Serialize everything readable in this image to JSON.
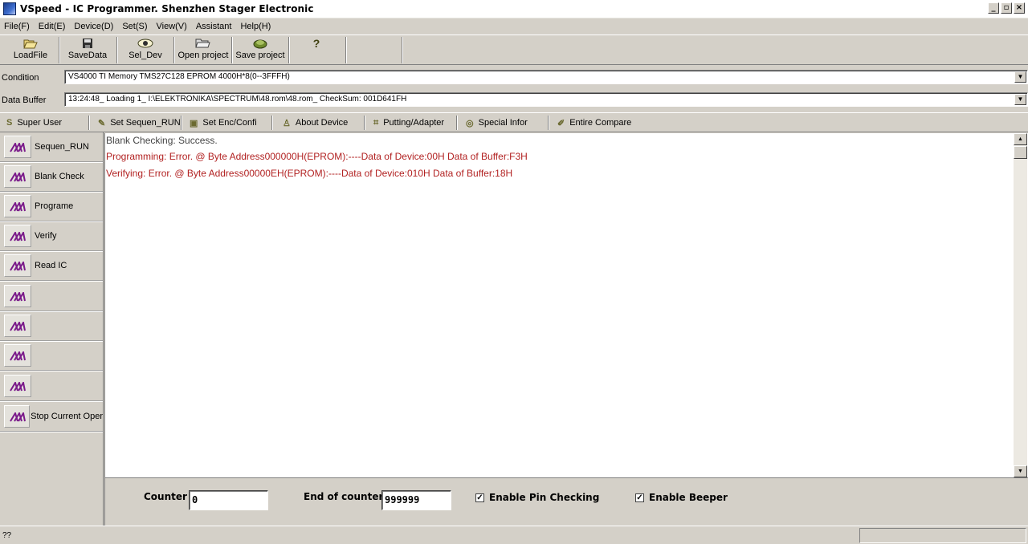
{
  "window": {
    "title": "VSpeed - IC Programmer.  Shenzhen Stager Electronic",
    "controls": [
      "_",
      "▫",
      "×"
    ]
  },
  "menu": [
    "File(F)",
    "Edit(E)",
    "Device(D)",
    "Set(S)",
    "View(V)",
    "Assistant",
    "Help(H)"
  ],
  "toolbar": {
    "load_file": "LoadFile",
    "save_data": "SaveData",
    "sel_dev": "Sel_Dev",
    "open_project": "Open project",
    "save_project": "Save project",
    "help": "?"
  },
  "condition": {
    "label": "Condition",
    "value": "VS4000  TI   Memory  TMS27C128  EPROM 4000H*8(0--3FFFH)"
  },
  "data_buffer": {
    "label": "Data Buffer",
    "value": "13:24:48_ Loading 1_ I:\\ELEKTRONIKA\\SPECTRUM\\48.rom\\48.rom_  CheckSum: 001D641FH"
  },
  "tabs": [
    "Super User",
    "Set Sequen_RUN",
    "Set Enc/Confi",
    "About Device",
    "Putting/Adapter",
    "Special Infor",
    "Entire Compare"
  ],
  "operations": [
    "Sequen_RUN",
    "Blank Check",
    "Programe",
    "Verify",
    "Read IC",
    "",
    "",
    "",
    "",
    "Stop Current Oper"
  ],
  "log": {
    "lines": [
      {
        "text": "Blank Checking:  Success.",
        "color": "#444444"
      },
      {
        "text": "Programming:  Error.   @ Byte Address000000H(EPROM):----Data of Device:00H     Data of Buffer:F3H",
        "color": "#b22222"
      },
      {
        "text": "Verifying:  Error.   @ Byte Address00000EH(EPROM):----Data of Device:010H     Data of Buffer:18H",
        "color": "#b22222"
      }
    ]
  },
  "counter": {
    "counter_label": "Counter",
    "counter_value": "0",
    "end_label": "End of counter",
    "end_value": "999999",
    "pin_check_label": "Enable Pin Checking",
    "pin_check_checked": true,
    "beeper_label": "Enable Beeper",
    "beeper_checked": true
  },
  "status": {
    "text": "??"
  }
}
